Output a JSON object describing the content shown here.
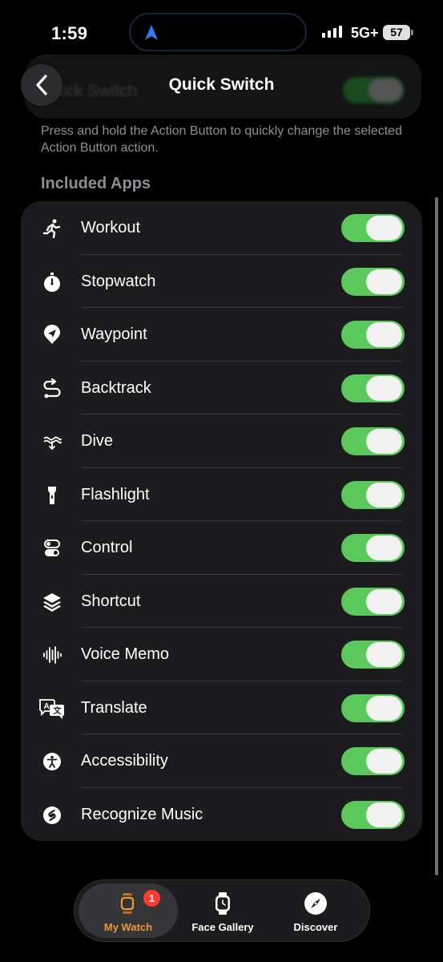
{
  "status_bar": {
    "time": "1:59",
    "network": "5G+",
    "battery": "57"
  },
  "header": {
    "title": "Quick Switch",
    "ghost_title": "Quick Switch"
  },
  "description": "Press and hold the Action Button to quickly change the selected Action Button action.",
  "section_header": "Included Apps",
  "apps": [
    {
      "label": "Workout",
      "icon": "workout-icon",
      "enabled": true
    },
    {
      "label": "Stopwatch",
      "icon": "stopwatch-icon",
      "enabled": true
    },
    {
      "label": "Waypoint",
      "icon": "waypoint-icon",
      "enabled": true
    },
    {
      "label": "Backtrack",
      "icon": "backtrack-icon",
      "enabled": true
    },
    {
      "label": "Dive",
      "icon": "dive-icon",
      "enabled": true
    },
    {
      "label": "Flashlight",
      "icon": "flashlight-icon",
      "enabled": true
    },
    {
      "label": "Control",
      "icon": "control-icon",
      "enabled": true
    },
    {
      "label": "Shortcut",
      "icon": "shortcut-icon",
      "enabled": true
    },
    {
      "label": "Voice Memo",
      "icon": "voice-memo-icon",
      "enabled": true
    },
    {
      "label": "Translate",
      "icon": "translate-icon",
      "enabled": true
    },
    {
      "label": "Accessibility",
      "icon": "accessibility-icon",
      "enabled": true
    },
    {
      "label": "Recognize Music",
      "icon": "recognize-music-icon",
      "enabled": true
    }
  ],
  "tab_bar": {
    "tabs": [
      {
        "label": "My Watch",
        "icon": "watch-icon",
        "active": true,
        "badge": "1"
      },
      {
        "label": "Face Gallery",
        "icon": "face-gallery-icon",
        "active": false
      },
      {
        "label": "Discover",
        "icon": "compass-icon",
        "active": false
      }
    ]
  },
  "colors": {
    "toggle_on": "#5ac85a",
    "accent": "#e8963a",
    "badge": "#ff3b30",
    "location": "#2f7bf5"
  }
}
